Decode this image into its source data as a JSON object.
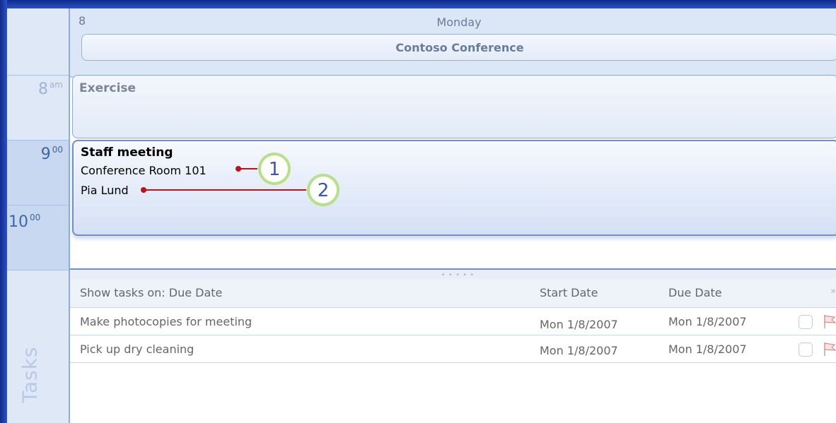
{
  "day": {
    "number": "8",
    "name": "Monday"
  },
  "all_day_event": "Contoso Conference",
  "time_labels": {
    "eight": {
      "hour": "8",
      "suffix": "am"
    },
    "nine": {
      "hour": "9",
      "suffix": "00"
    },
    "ten": {
      "hour": "10",
      "suffix": "00"
    }
  },
  "appointments": {
    "exercise": {
      "title": "Exercise"
    },
    "staff": {
      "title": "Staff meeting",
      "location": "Conference Room 101",
      "organizer": "Pia Lund"
    }
  },
  "callouts": [
    "1",
    "2"
  ],
  "tasks_pane": {
    "label": "Tasks",
    "headers": {
      "show": "Show tasks on: Due Date",
      "start": "Start Date",
      "due": "Due Date"
    },
    "rows": [
      {
        "name": "Make photocopies for meeting",
        "start": "Mon 1/8/2007",
        "due": "Mon 1/8/2007"
      },
      {
        "name": "Pick up dry cleaning",
        "start": "Mon 1/8/2007",
        "due": "Mon 1/8/2007"
      }
    ]
  },
  "colors": {
    "accent": "#1f3f9e",
    "callout_fill": "#b7e08a",
    "leader_line": "#c0111a"
  }
}
